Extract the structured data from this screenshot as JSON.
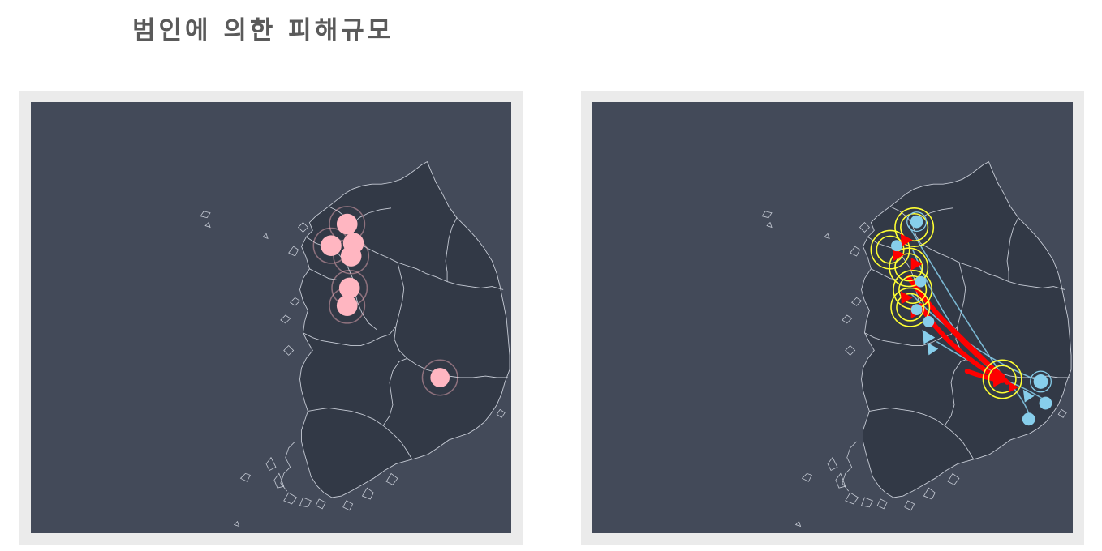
{
  "header": {
    "title": "범인에 의한 피해규모"
  },
  "colors": {
    "background": "#ffffff",
    "panel_frame": "#ebebeb",
    "map_ocean": "#434a59",
    "map_land": "#323946",
    "map_border": "#c7ccd6",
    "damage_marker": "#ffb6c1",
    "origin_marker": "#87ceeb",
    "flow_arrow": "#ff0000",
    "highlight_ring": "#ffff33"
  },
  "maps": [
    {
      "id": "damage-scale-map",
      "marker_icon": "pink-circle-icon"
    },
    {
      "id": "flow-map",
      "marker_icons": [
        "blue-arrow-icon",
        "red-arrow-icon",
        "yellow-ring-icon"
      ]
    }
  ]
}
